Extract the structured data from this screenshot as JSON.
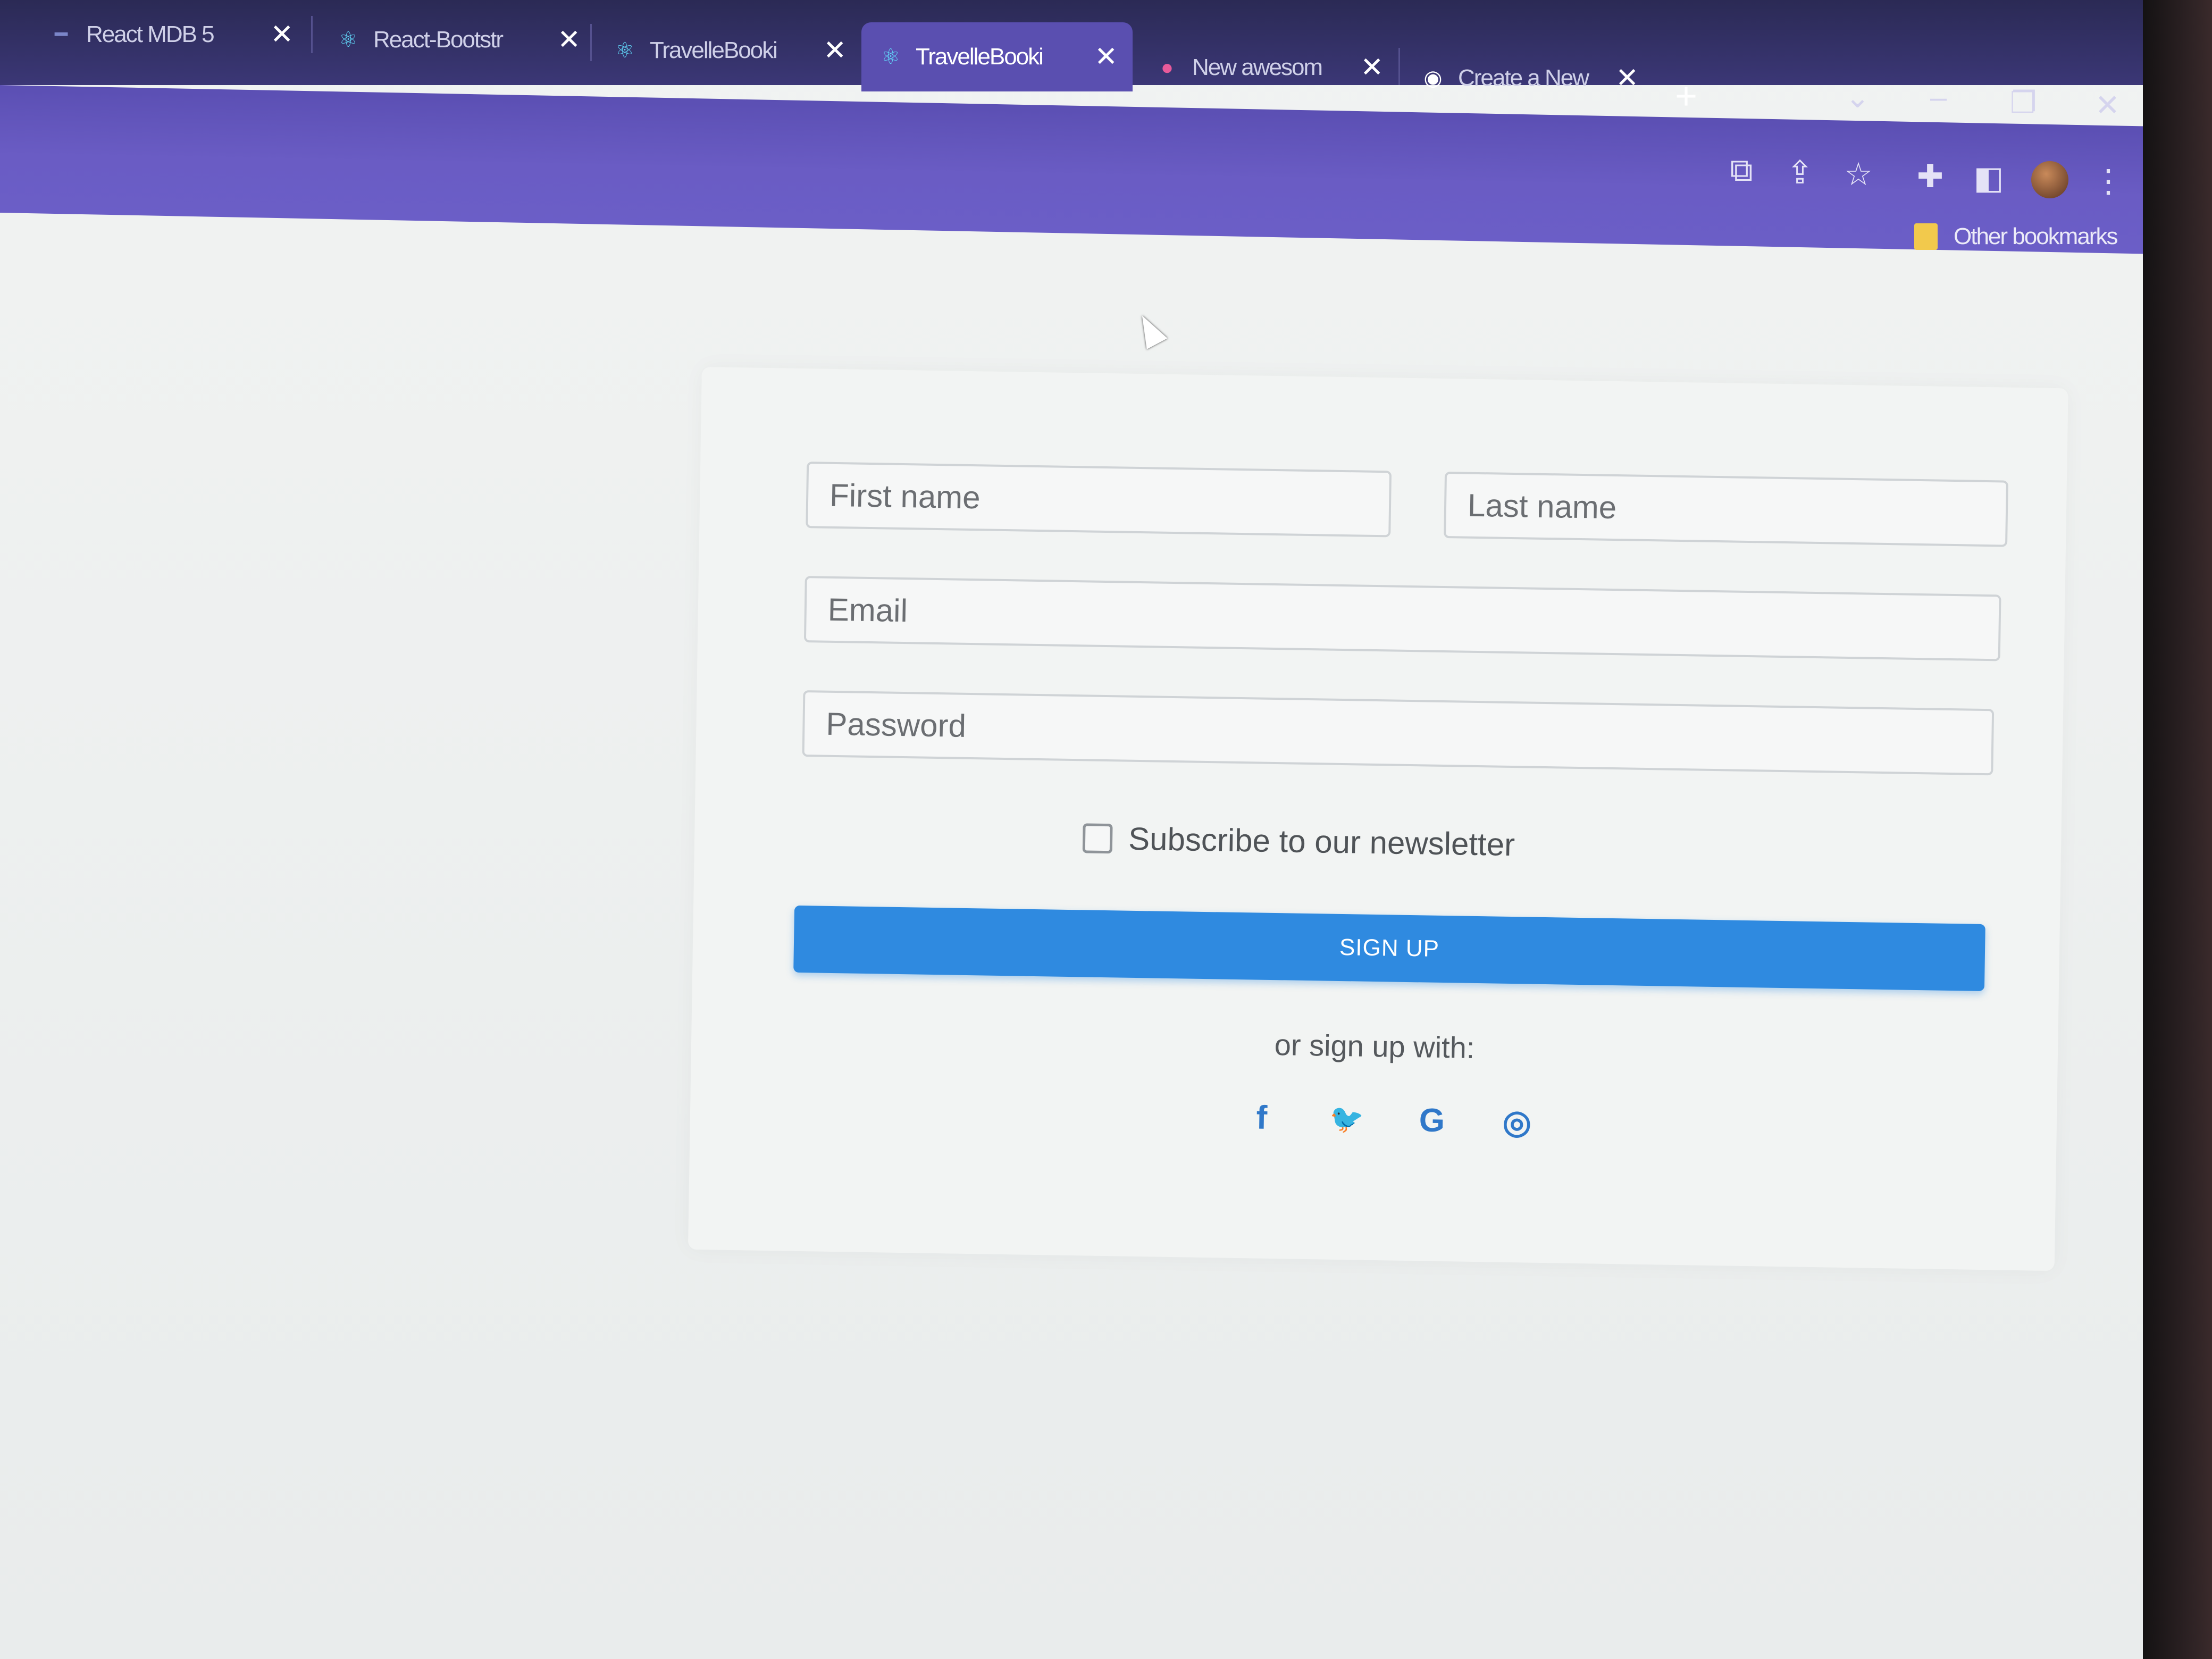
{
  "browser": {
    "tabs": [
      {
        "title": "React MDB 5",
        "favicon": "mdb-icon",
        "active": false
      },
      {
        "title": "React-Bootstr",
        "favicon": "react-icon",
        "active": false
      },
      {
        "title": "TravelleBooki",
        "favicon": "react-icon",
        "active": false
      },
      {
        "title": "TravelleBooki",
        "favicon": "react-icon",
        "active": true
      },
      {
        "title": "New awesom",
        "favicon": "firefox-icon",
        "active": false
      },
      {
        "title": "Create a New",
        "favicon": "github-icon",
        "active": false
      }
    ],
    "new_tab": "+",
    "bookmarks_label": "Other bookmarks"
  },
  "form": {
    "first_name_placeholder": "First name",
    "last_name_placeholder": "Last name",
    "email_placeholder": "Email",
    "password_placeholder": "Password",
    "newsletter_label": "Subscribe to our newsletter",
    "submit_label": "SIGN UP",
    "alt_signup_text": "or sign up with:",
    "social_buttons": [
      {
        "icon": "facebook-icon",
        "glyph": "f"
      },
      {
        "icon": "twitter-icon",
        "glyph": "🐦"
      },
      {
        "icon": "google-icon",
        "glyph": "G"
      },
      {
        "icon": "github-icon",
        "glyph": "◎"
      }
    ]
  },
  "colors": {
    "primary": "#2f8ae0",
    "toolbar": "#6a5cc4",
    "tabstrip": "#2b2a55"
  }
}
